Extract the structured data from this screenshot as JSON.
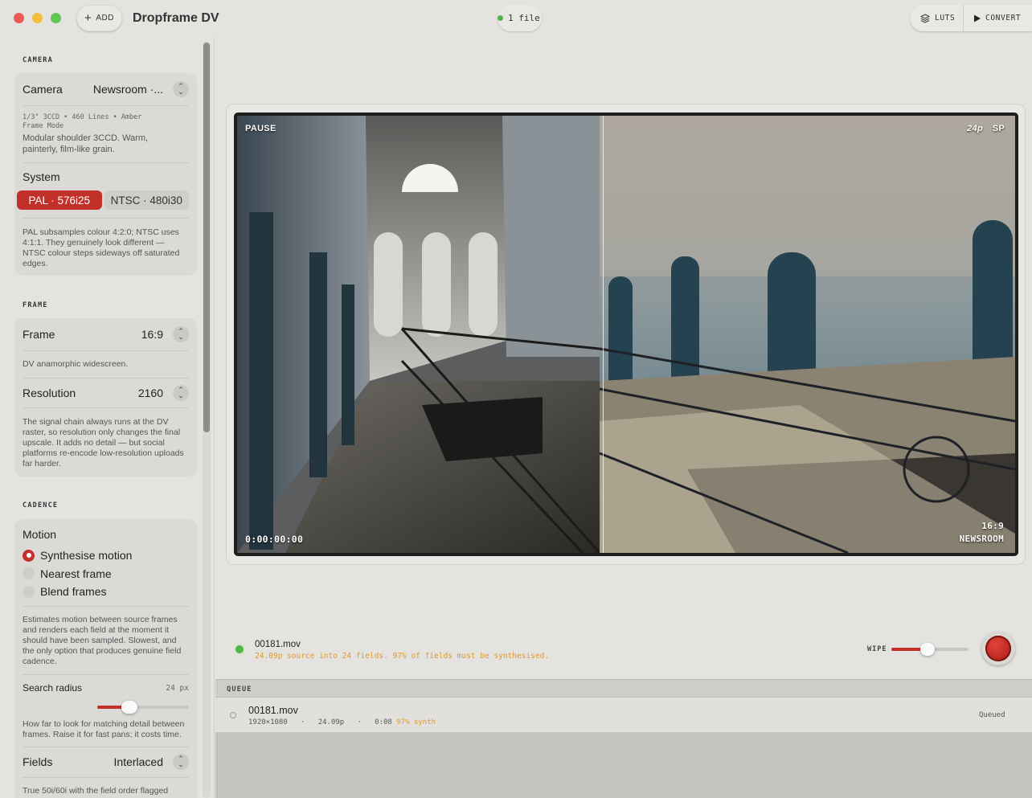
{
  "titlebar": {
    "add_label": "ADD",
    "app_title": "Dropframe DV",
    "file_count": "1 file",
    "luts_label": "LUTS",
    "convert_label": "CONVERT"
  },
  "sidebar": {
    "camera": {
      "section": "CAMERA",
      "label": "Camera",
      "value": "Newsroom ·...",
      "spec_line1": "1/3\" 3CCD • 460 Lines • Amber",
      "spec_line2": "Frame Mode",
      "desc": "Modular shoulder 3CCD. Warm, painterly, film-like grain.",
      "system_label": "System",
      "system_options": [
        "PAL · 576i25",
        "NTSC · 480i30"
      ],
      "system_selected": "PAL · 576i25",
      "system_desc": "PAL subsamples colour 4:2:0; NTSC uses 4:1:1. They genuinely look different — NTSC colour steps sideways off saturated edges."
    },
    "frame": {
      "section": "FRAME",
      "label": "Frame",
      "value": "16:9",
      "desc": "DV anamorphic widescreen.",
      "resolution_label": "Resolution",
      "resolution_value": "2160",
      "resolution_desc": "The signal chain always runs at the DV raster, so resolution only changes the final upscale. It adds no detail — but social platforms re-encode low-resolution uploads far harder."
    },
    "cadence": {
      "section": "CADENCE",
      "motion_label": "Motion",
      "motion_options": [
        "Synthesise motion",
        "Nearest frame",
        "Blend frames"
      ],
      "motion_selected": "Synthesise motion",
      "motion_desc": "Estimates motion between source frames and renders each field at the moment it should have been sampled. Slowest, and the only option that produces genuine field cadence.",
      "search_label": "Search radius",
      "search_value": "24 px",
      "search_fraction": 0.35,
      "search_desc": "How far to look for matching detail between frames. Raise it for fast pans; it costs time.",
      "fields_label": "Fields",
      "fields_value": "Interlaced",
      "fields_desc": "True 50i/60i with the field order flagged"
    }
  },
  "viewer": {
    "status": "PAUSE",
    "rate": "24p",
    "mode": "SP",
    "timecode": "0:00:00:00",
    "aspect": "16:9",
    "camera": "NEWSROOM",
    "wipe_fraction": 0.47
  },
  "now_playing": {
    "file": "00181.mov",
    "info": "24.09p source into 24 fields. 97% of fields must be synthesised.",
    "wipe_label": "WIPE",
    "wipe_fraction": 0.47
  },
  "queue": {
    "title": "QUEUE",
    "items": [
      {
        "name": "00181.mov",
        "resolution": "1920×1080",
        "rate": "24.09p",
        "duration": "0:08",
        "synth": "97% synth",
        "status": "Queued"
      }
    ]
  },
  "colors": {
    "accent": "#c2302a",
    "status_green": "#52b548",
    "warning_amber": "#e09a2a"
  }
}
